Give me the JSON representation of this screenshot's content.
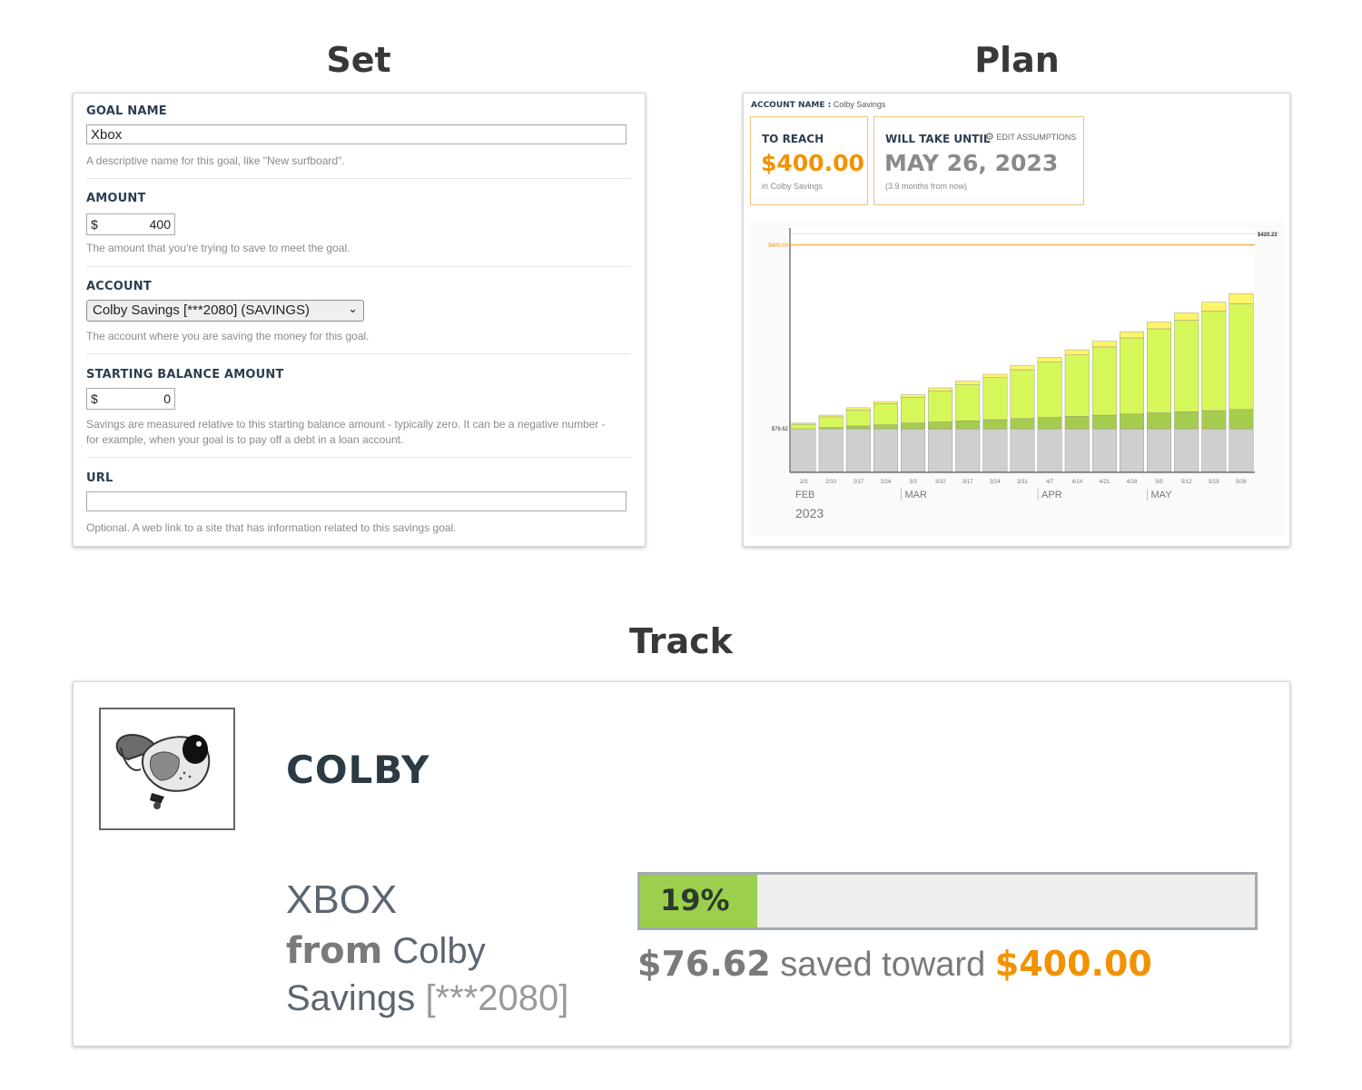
{
  "sections": {
    "set": "Set",
    "plan": "Plan",
    "track": "Track"
  },
  "set_form": {
    "goal_name": {
      "label": "GOAL NAME",
      "value": "Xbox",
      "help": "A descriptive name for this goal, like \"New surfboard\"."
    },
    "amount": {
      "label": "AMOUNT",
      "currency": "$",
      "value": "400",
      "help": "The amount that you're trying to save to meet the goal."
    },
    "account": {
      "label": "ACCOUNT",
      "selected": "Colby Savings [***2080] (SAVINGS)",
      "help": "The account where you are saving the money for this goal."
    },
    "starting_balance": {
      "label": "STARTING BALANCE AMOUNT",
      "currency": "$",
      "value": "0",
      "help_line1": "Savings are measured relative to this starting balance amount - typically zero. It can be a negative number -",
      "help_line2": "for example, when your goal is to pay off a debt in a loan account."
    },
    "url": {
      "label": "URL",
      "value": "",
      "help": "Optional. A web link to a site that has information related to this savings goal."
    }
  },
  "plan": {
    "account_label": "ACCOUNT NAME :",
    "account_name": "Colby Savings",
    "to_reach": {
      "label": "TO REACH",
      "amount": "$400.00",
      "sub": "in Colby Savings"
    },
    "will_take": {
      "label": "WILL TAKE UNTIL",
      "date": "MAY 26, 2023",
      "sub": "(3.9 months from now)",
      "edit": "EDIT ASSUMPTIONS"
    }
  },
  "chart_data": {
    "type": "bar",
    "stacked": true,
    "categories": [
      "2/3",
      "2/10",
      "2/17",
      "2/24",
      "3/3",
      "3/10",
      "3/17",
      "3/24",
      "3/31",
      "4/7",
      "4/14",
      "4/21",
      "4/28",
      "5/5",
      "5/12",
      "5/19",
      "5/26"
    ],
    "month_labels": [
      {
        "label": "FEB",
        "category": "2/3"
      },
      {
        "label": "MAR",
        "category": "3/3"
      },
      {
        "label": "APR",
        "category": "4/7"
      },
      {
        "label": "MAY",
        "category": "5/5"
      }
    ],
    "year_label": "2023",
    "series": [
      {
        "color": "#cfcfcf",
        "values": [
          76.62,
          76.62,
          76.62,
          76.62,
          76.62,
          76.62,
          76.62,
          76.62,
          76.62,
          76.62,
          76.62,
          76.62,
          76.62,
          76.62,
          76.62,
          76.62,
          76.62
        ]
      },
      {
        "color": "#a6cc4f",
        "values": [
          0,
          2,
          5,
          7,
          10,
          12,
          14,
          16,
          18,
          20,
          22,
          24,
          26,
          28,
          30,
          32,
          34
        ]
      },
      {
        "color": "#d6f75a",
        "values": [
          8,
          19,
          28,
          37,
          45,
          55,
          64,
          74,
          86,
          98,
          108,
          120,
          134,
          148,
          161,
          175,
          186
        ]
      },
      {
        "color": "#fdf46a",
        "values": [
          2,
          3,
          4,
          4,
          5,
          5,
          6,
          6,
          7,
          8,
          9,
          10,
          11,
          12,
          13,
          16,
          18
        ]
      }
    ],
    "goal_line": {
      "value": 400,
      "label": "$400.00",
      "color": "#f39200"
    },
    "annotations": [
      {
        "value": 420.22,
        "label": "$420.22"
      },
      {
        "value": 76.62,
        "label": "$76.62"
      }
    ],
    "ylim": [
      0,
      430
    ]
  },
  "track": {
    "user": "COLBY",
    "goal_name": "XBOX",
    "from_word": "from",
    "account": "Colby Savings",
    "account_mask": "[***2080]",
    "progress_fraction": 0.19,
    "progress_label": "19%",
    "saved": "$76.62",
    "saved_text": "saved toward",
    "target": "$400.00"
  },
  "colors": {
    "accent_orange": "#f39200",
    "progress_green": "#9bcf4d"
  },
  "icons": {
    "gear": "gear-icon",
    "chevron": "chevron-down-icon"
  }
}
